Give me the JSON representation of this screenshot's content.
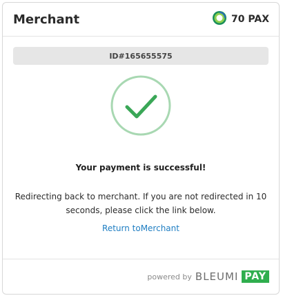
{
  "header": {
    "merchant_name": "Merchant",
    "amount": "70 PAX",
    "currency_icon": "pax-coin-icon"
  },
  "payment": {
    "id_label": "ID#165655575",
    "status_icon": "success-check-icon",
    "headline": "Your payment is successful!",
    "message": "Redirecting back to merchant. If you are not redirected in 10 seconds, please click the link below.",
    "return_link": "Return toMerchant"
  },
  "footer": {
    "powered_by": "powered by",
    "brand_name": "BLEUMI",
    "brand_suffix": "PAY"
  },
  "colors": {
    "success_green": "#3aa757",
    "success_ring": "#a8d8b2",
    "link_blue": "#1e7dc2",
    "brand_green": "#2fae4e"
  }
}
